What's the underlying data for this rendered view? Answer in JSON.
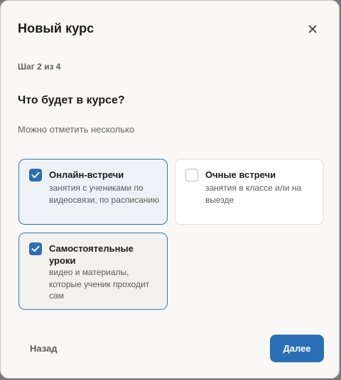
{
  "dialog": {
    "title": "Новый курс",
    "close_icon": "close-icon",
    "step": "Шаг 2 из 4",
    "question": "Что будет в курсе?",
    "hint": "Можно отметить несколько"
  },
  "options": [
    {
      "title": "Онлайн-встречи",
      "description": "занятия с учениками по видеосвязи, по расписанию",
      "checked": true
    },
    {
      "title": "Очные встречи",
      "description": "занятия в классе или на выезде",
      "checked": false
    },
    {
      "title": "Самостоятельные уроки",
      "description": "видео и материалы, которые ученик проходит сам",
      "checked": true
    }
  ],
  "footer": {
    "back_label": "Назад",
    "next_label": "Далее"
  },
  "colors": {
    "accent": "#2a6fb5",
    "background": "#f9f8f6"
  }
}
